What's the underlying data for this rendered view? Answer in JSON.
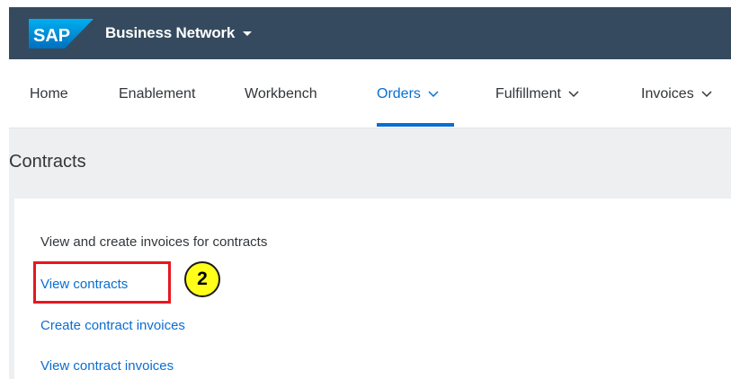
{
  "header": {
    "logo_text": "SAP",
    "product_name": "Business Network",
    "background_color": "#354a5f"
  },
  "nav": {
    "items": [
      {
        "label": "Home",
        "has_dropdown": false,
        "active": false
      },
      {
        "label": "Enablement",
        "has_dropdown": false,
        "active": false
      },
      {
        "label": "Workbench",
        "has_dropdown": false,
        "active": false
      },
      {
        "label": "Orders",
        "has_dropdown": true,
        "active": true
      },
      {
        "label": "Fulfillment",
        "has_dropdown": true,
        "active": false
      },
      {
        "label": "Invoices",
        "has_dropdown": true,
        "active": false
      }
    ],
    "active_color": "#0a6ed1"
  },
  "page": {
    "title": "Contracts"
  },
  "card": {
    "description": "View and create invoices for contracts",
    "links": [
      {
        "label": "View contracts"
      },
      {
        "label": "Create contract invoices"
      },
      {
        "label": "View contract invoices"
      }
    ]
  },
  "annotation": {
    "step_number": "2",
    "highlight_color": "#e8171f",
    "badge_color": "#ffff1a"
  }
}
